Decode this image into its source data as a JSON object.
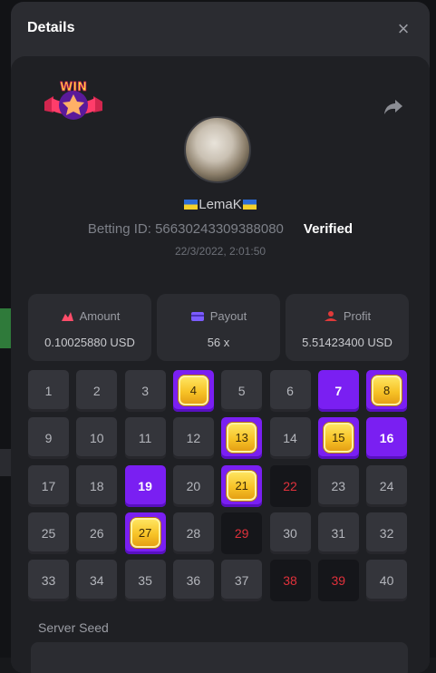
{
  "modal": {
    "title": "Details",
    "close_label": "×"
  },
  "user": {
    "name": "LemaK",
    "betting_id_label": "Betting ID: 56630243309388080",
    "verified_label": "Verified",
    "timestamp": "22/3/2022, 2:01:50"
  },
  "badge": {
    "text": "WIN"
  },
  "stats": {
    "amount": {
      "label": "Amount",
      "value": "0.10025880 USD"
    },
    "payout": {
      "label": "Payout",
      "value": "56 x"
    },
    "profit": {
      "label": "Profit",
      "value": "5.51423400 USD"
    }
  },
  "grid": {
    "cells": [
      {
        "n": "1",
        "state": "normal"
      },
      {
        "n": "2",
        "state": "normal"
      },
      {
        "n": "3",
        "state": "normal"
      },
      {
        "n": "4",
        "state": "hit"
      },
      {
        "n": "5",
        "state": "normal"
      },
      {
        "n": "6",
        "state": "normal"
      },
      {
        "n": "7",
        "state": "pick"
      },
      {
        "n": "8",
        "state": "hit"
      },
      {
        "n": "9",
        "state": "normal"
      },
      {
        "n": "10",
        "state": "normal"
      },
      {
        "n": "11",
        "state": "normal"
      },
      {
        "n": "12",
        "state": "normal"
      },
      {
        "n": "13",
        "state": "hit"
      },
      {
        "n": "14",
        "state": "normal"
      },
      {
        "n": "15",
        "state": "hit"
      },
      {
        "n": "16",
        "state": "pick"
      },
      {
        "n": "17",
        "state": "normal"
      },
      {
        "n": "18",
        "state": "normal"
      },
      {
        "n": "19",
        "state": "pick"
      },
      {
        "n": "20",
        "state": "normal"
      },
      {
        "n": "21",
        "state": "hit"
      },
      {
        "n": "22",
        "state": "miss"
      },
      {
        "n": "23",
        "state": "normal"
      },
      {
        "n": "24",
        "state": "normal"
      },
      {
        "n": "25",
        "state": "normal"
      },
      {
        "n": "26",
        "state": "normal"
      },
      {
        "n": "27",
        "state": "hit"
      },
      {
        "n": "28",
        "state": "normal"
      },
      {
        "n": "29",
        "state": "miss"
      },
      {
        "n": "30",
        "state": "normal"
      },
      {
        "n": "31",
        "state": "normal"
      },
      {
        "n": "32",
        "state": "normal"
      },
      {
        "n": "33",
        "state": "normal"
      },
      {
        "n": "34",
        "state": "normal"
      },
      {
        "n": "35",
        "state": "normal"
      },
      {
        "n": "36",
        "state": "normal"
      },
      {
        "n": "37",
        "state": "normal"
      },
      {
        "n": "38",
        "state": "miss"
      },
      {
        "n": "39",
        "state": "miss"
      },
      {
        "n": "40",
        "state": "normal"
      }
    ]
  },
  "seed": {
    "label": "Server Seed"
  },
  "colors": {
    "accent": "#7a1ff2",
    "miss": "#e0313b",
    "gem": "#f7c327",
    "icon_pink": "#ff4d6a",
    "icon_purple": "#7c5cff",
    "icon_red": "#e03a3a"
  },
  "icons": {
    "close": "close-icon",
    "share": "share-icon",
    "amount": "amount-icon",
    "payout": "wallet-icon",
    "profit": "profit-icon"
  }
}
